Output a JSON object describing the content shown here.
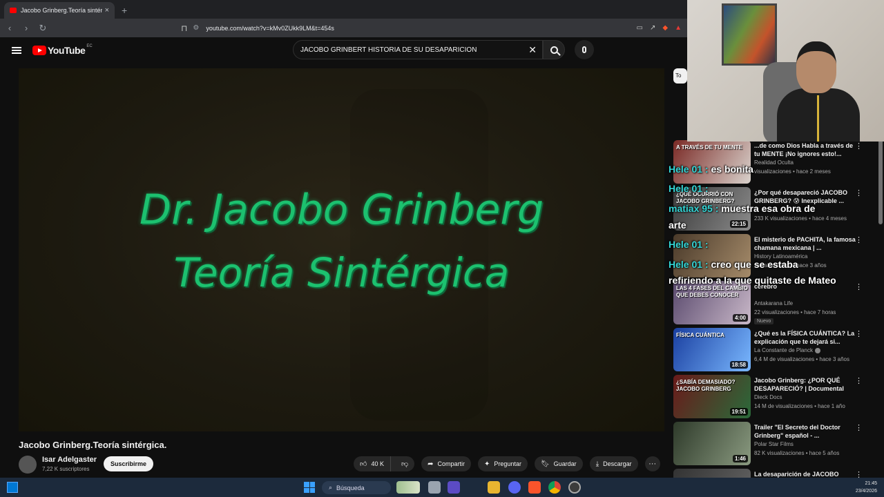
{
  "browser": {
    "tab_title": "Jacobo Grinberg.Teoría sintérgi",
    "tab_close": "×",
    "new_tab": "+",
    "url": "youtube.com/watch?v=kMv0ZUkk9LM&t=454s"
  },
  "header": {
    "logo_text": "YouTube",
    "logo_region": "EC",
    "search_query": "JACOBO GRINBERT HISTORIA DE SU DESAPARICION"
  },
  "video": {
    "overlay_line1": "Dr. Jacobo Grinberg",
    "overlay_line2": "Teoría Sintérgica",
    "title": "Jacobo Grinberg.Teoría sintérgica.",
    "channel": "Isar Adelgaster",
    "subscribers": "7,22 K suscriptores",
    "subscribe_label": "Suscribirme",
    "likes": "40 K",
    "share_label": "Compartir",
    "ask_label": "Preguntar",
    "save_label": "Guardar",
    "download_label": "Descargar",
    "more_label": "···"
  },
  "sidebar": {
    "chip_label": "To",
    "items": [
      {
        "title": "...de como Dios Habla a través de tu MENTE ¡No ignores esto!...",
        "channel": "Realidad Oculta",
        "meta": "visualizaciones • hace 2 meses",
        "duration": "",
        "thumb_text": "A TRAVÉS DE TU MENTE",
        "colors": [
          "#7a2a26",
          "#d9d2cc"
        ]
      },
      {
        "title": "¿Por qué desapareció JACOBO GRINBERG? 😰 Inexplicable ...",
        "channel": "",
        "meta": "233 K visualizaciones • hace 4 meses",
        "duration": "22:15",
        "thumb_text": "¿QUÉ OCURRIÓ CON JACOBO GRINBERG?",
        "colors": [
          "#3a3a3a",
          "#8a8a8a"
        ]
      },
      {
        "title": "El misterio de PACHITA, la famosa chamana mexicana | ...",
        "channel": "History Latinoamérica",
        "meta": "visualizaciones • hace 3 años",
        "duration": "",
        "thumb_text": "",
        "colors": [
          "#4a3a2a",
          "#a58b6a"
        ]
      },
      {
        "title": "cerebro",
        "channel": "Antakarana Life",
        "meta": "22 visualizaciones • hace 7 horas",
        "duration": "4:00",
        "thumb_text": "LAS 4 FASES DEL CAMBIO QUE DEBES CONOCER",
        "badge": "Nuevo",
        "colors": [
          "#5a4a6e",
          "#c9b8c8"
        ]
      },
      {
        "title": "¿Qué es la FÍSICA CUÁNTICA? La explicación que te dejará si...",
        "channel": "La Constante de Planck",
        "meta": "6,4 M de visualizaciones • hace 3 años",
        "duration": "18:58",
        "thumb_text": "FÍSICA CUÁNTICA",
        "colors": [
          "#1a3fa0",
          "#7ab8ff"
        ]
      },
      {
        "title": "Jacobo Grinberg: ¿POR QUÉ DESAPARECIÓ? | Documental",
        "channel": "Dieck Docs",
        "meta": "14 M de visualizaciones • hace 1 año",
        "duration": "19:51",
        "thumb_text": "¿SABÍA DEMASIADO? JACOBO GRINBERG",
        "colors": [
          "#6a1a1a",
          "#2a6a3a"
        ]
      },
      {
        "title": "Trailer \"El Secreto del Doctor Grinberg\" español - ...",
        "channel": "Polar Star Films",
        "meta": "82 K visualizaciones • hace 5 años",
        "duration": "1:46",
        "thumb_text": "",
        "colors": [
          "#2e3a2a",
          "#8a9a80"
        ]
      },
      {
        "title": "La desaparición de JACOBO",
        "channel": "",
        "meta": "",
        "duration": "",
        "thumb_text": "",
        "colors": [
          "#333",
          "#666"
        ]
      }
    ]
  },
  "chat": [
    {
      "user": "Hele 01 :",
      "text": "es bonita"
    },
    {
      "user": "Hele 01 :",
      "text": ""
    },
    {
      "user": "matiax 95 :",
      "text": "muestra esa obra de"
    },
    {
      "user": "",
      "text": "arte"
    },
    {
      "user": "Hele 01 :",
      "text": ""
    },
    {
      "user": "Hele 01 :",
      "text": "creo que se estaba"
    },
    {
      "user": "",
      "text": "refiriendo a la que quitaste de Mateo"
    }
  ],
  "taskbar": {
    "search_label": "Búsqueda",
    "time": "21:45",
    "date": "23/4/2026"
  }
}
